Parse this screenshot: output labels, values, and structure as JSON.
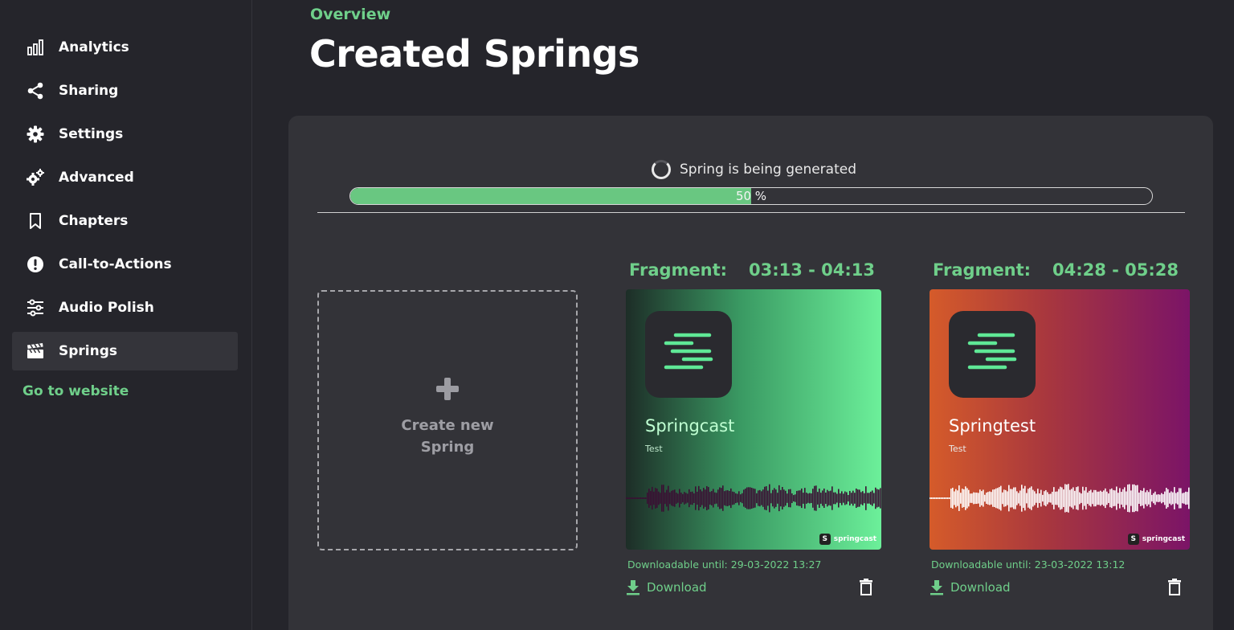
{
  "sidebar": {
    "items": [
      {
        "label": "Analytics",
        "icon": "bar-chart-icon"
      },
      {
        "label": "Sharing",
        "icon": "share-icon"
      },
      {
        "label": "Settings",
        "icon": "gear-icon"
      },
      {
        "label": "Advanced",
        "icon": "gears-icon"
      },
      {
        "label": "Chapters",
        "icon": "bookmark-icon"
      },
      {
        "label": "Call-to-Actions",
        "icon": "exclamation-icon"
      },
      {
        "label": "Audio Polish",
        "icon": "sliders-icon"
      },
      {
        "label": "Springs",
        "icon": "clapperboard-icon",
        "active": true
      }
    ],
    "go_website": "Go to website"
  },
  "header": {
    "overview": "Overview",
    "title": "Created Springs"
  },
  "generation": {
    "status": "Spring is being generated",
    "progress_percent": 50,
    "progress_text": "50 %"
  },
  "create": {
    "line1": "Create new",
    "line2": "Spring"
  },
  "fragments": [
    {
      "label": "Fragment:",
      "time": "03:13 - 04:13",
      "cover_title": "Springcast",
      "cover_sub": "Test",
      "brand": "springcast",
      "downloadable": "Downloadable until: 29-03-2022 13:27",
      "download_label": "Download"
    },
    {
      "label": "Fragment:",
      "time": "04:28 - 05:28",
      "cover_title": "Springtest",
      "cover_sub": "Test",
      "brand": "springcast",
      "downloadable": "Downloadable until: 23-03-2022 13:12",
      "download_label": "Download"
    }
  ],
  "colors": {
    "accent": "#6fcf8a",
    "background": "#25252b",
    "panel": "#333338"
  }
}
